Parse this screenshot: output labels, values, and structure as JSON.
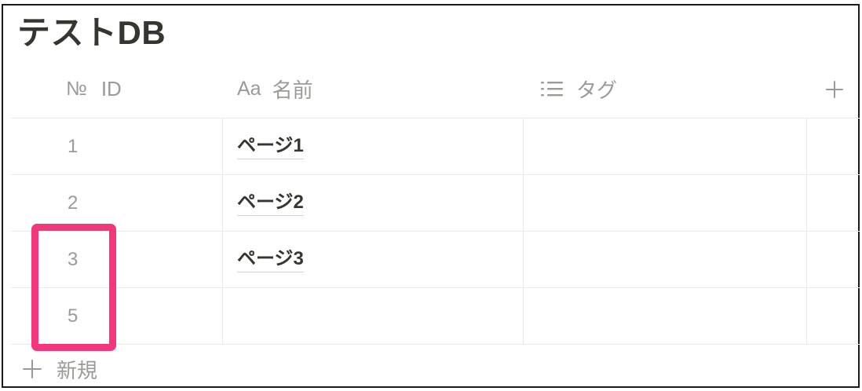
{
  "page": {
    "title": "テストDB"
  },
  "table": {
    "columns": [
      {
        "icon": "number-icon",
        "glyph": "№",
        "label": "ID"
      },
      {
        "icon": "text-icon",
        "glyph": "Aa",
        "label": "名前"
      },
      {
        "icon": "list-icon",
        "label": "タグ"
      }
    ],
    "add_column_icon": "plus-icon",
    "rows": [
      {
        "id": "1",
        "name": "ページ1",
        "tag": ""
      },
      {
        "id": "2",
        "name": "ページ2",
        "tag": ""
      },
      {
        "id": "3",
        "name": "ページ3",
        "tag": ""
      },
      {
        "id": "5",
        "name": "",
        "tag": ""
      }
    ],
    "new_row": {
      "icon": "plus-icon",
      "label": "新規"
    }
  },
  "colors": {
    "text": "#37352f",
    "muted": "#9b9a97",
    "divider": "#e9e9e7",
    "highlight": "#f4367c",
    "frame": "#1a1a1a"
  }
}
